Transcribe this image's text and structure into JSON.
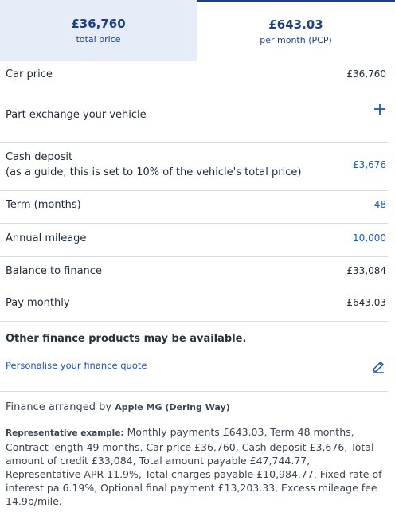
{
  "tabs": [
    {
      "amount": "£36,760",
      "sub": "total price"
    },
    {
      "amount": "£643.03",
      "sub": "per month (PCP)"
    }
  ],
  "rows": {
    "car_price": {
      "label": "Car price",
      "value": "£36,760"
    },
    "part_exchange": {
      "label": "Part exchange your vehicle",
      "icon": "plus-icon"
    },
    "cash_deposit": {
      "label_line1": "Cash deposit",
      "label_line2": "(as a guide, this is set to 10% of the vehicle's total price)",
      "value": "£3,676"
    },
    "term": {
      "label": "Term (months)",
      "value": "48"
    },
    "mileage": {
      "label": "Annual mileage",
      "value": "10,000"
    },
    "balance": {
      "label": "Balance to finance",
      "value": "£33,084"
    },
    "pay_monthly": {
      "label": "Pay monthly",
      "value": "£643.03"
    }
  },
  "other_products": "Other finance products may be available.",
  "personalise_link": "Personalise your finance quote",
  "arranged": {
    "prefix": "Finance arranged by",
    "dealer": "Apple MG (Dering Way)"
  },
  "representative": {
    "label": "Representative example:",
    "text": "Monthly payments £643.03, Term 48 months, Contract length 49 months, Car price £36,760, Cash deposit £3,676, Total amount of credit £33,084, Total amount payable £47,744.77, Representative APR 11.9%, Total charges payable £10,984.77, Fixed rate of interest pa 6.19%, Optional final payment £13,203.33, Excess mileage fee 14.9p/mile."
  },
  "colors": {
    "accent": "#1d55c4",
    "tab_active_bg": "#e6ecf8",
    "tab_text": "#1d3f8a"
  }
}
